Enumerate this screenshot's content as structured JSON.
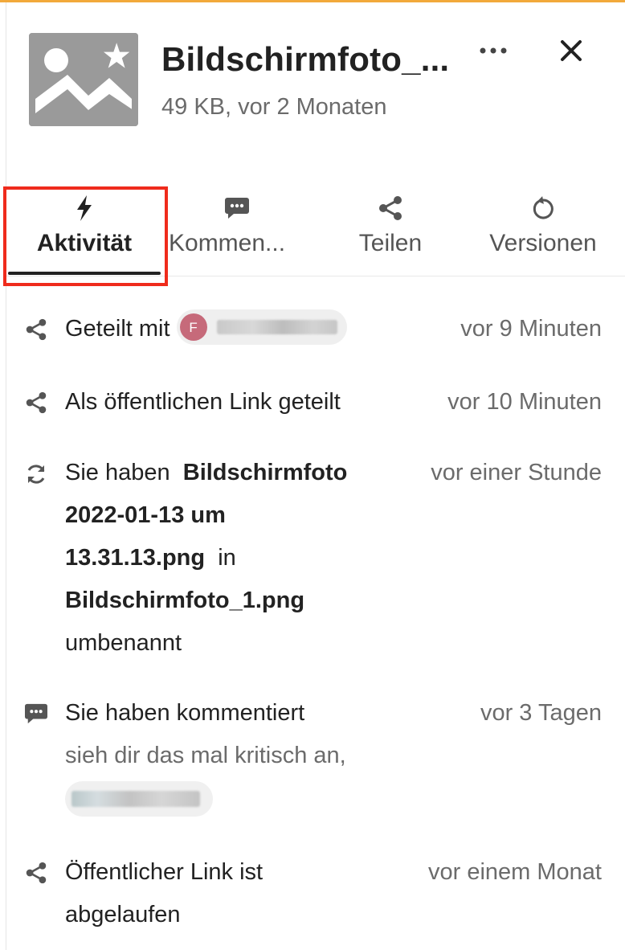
{
  "colors": {
    "accent_top": "#f2a93b",
    "highlight": "#ef2b1c",
    "text_primary": "#222222",
    "text_muted": "#6b6b6b",
    "avatar": "#c66a7a"
  },
  "header": {
    "thumbnail_icon": "image-placeholder-icon",
    "title": "Bildschirmfoto_...",
    "subtitle": "49 KB, vor 2 Monaten",
    "more_icon": "more-horizontal-icon",
    "close_icon": "close-icon"
  },
  "tabs": [
    {
      "label": "Aktivität",
      "icon": "lightning-icon",
      "active": true
    },
    {
      "label": "Kommen...",
      "icon": "comment-icon",
      "active": false
    },
    {
      "label": "Teilen",
      "icon": "share-icon",
      "active": false
    },
    {
      "label": "Versionen",
      "icon": "history-icon",
      "active": false
    }
  ],
  "activities": [
    {
      "icon": "share-icon",
      "text": "Geteilt mit",
      "user_initial": "F",
      "time": "vor 9 Minuten"
    },
    {
      "icon": "share-icon",
      "text": "Als öffentlichen Link geteilt",
      "time": "vor 10 Minuten"
    },
    {
      "icon": "rename-icon",
      "lines": [
        "Sie haben",
        "Bildschirmfoto",
        "2022-01-13 um",
        "13.31.13.png",
        "in",
        "Bildschirmfoto_1.png",
        "umbenannt"
      ],
      "time": "vor einer Stunde"
    },
    {
      "icon": "comment-icon",
      "text": "Sie haben kommentiert",
      "comment": "sieh dir das mal kritisch an,",
      "time": "vor 3 Tagen"
    },
    {
      "icon": "share-icon",
      "lines": [
        "Öffentlicher Link ist",
        "abgelaufen"
      ],
      "time": "vor einem Monat"
    }
  ]
}
